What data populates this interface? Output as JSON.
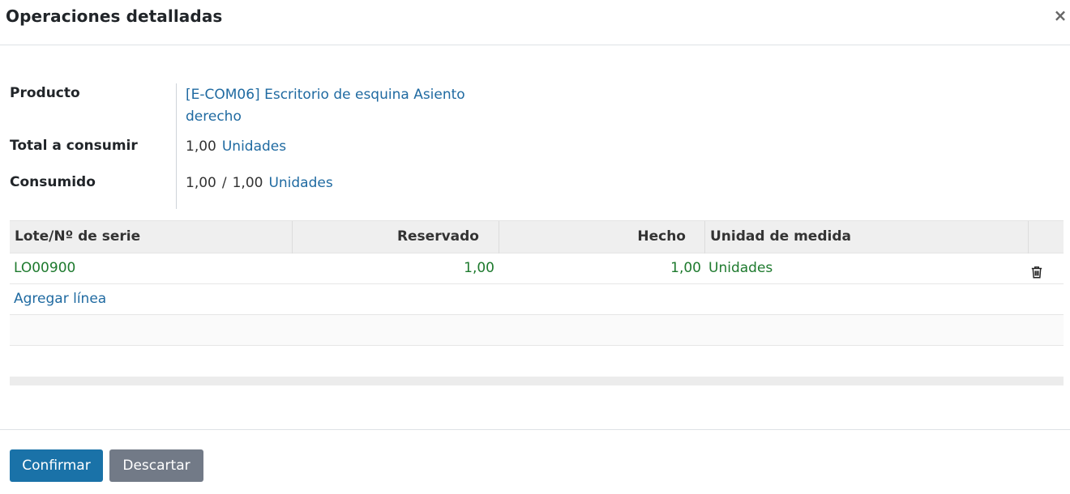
{
  "modal": {
    "title": "Operaciones detalladas",
    "close_label": "×"
  },
  "form": {
    "product_label": "Producto",
    "product_value": "[E-COM06] Escritorio de esquina Asiento derecho",
    "total_label": "Total a consumir",
    "total_qty": "1,00",
    "total_uom": "Unidades",
    "consumed_label": "Consumido",
    "consumed_qty": "1,00",
    "consumed_slash": "/",
    "consumed_total": "1,00",
    "consumed_uom": "Unidades"
  },
  "table": {
    "headers": {
      "lot": "Lote/Nº de serie",
      "reserved": "Reservado",
      "done": "Hecho",
      "uom": "Unidad de medida"
    },
    "rows": [
      {
        "lot": "LO00900",
        "reserved": "1,00",
        "done": "1,00",
        "uom": "Unidades"
      }
    ],
    "add_line_label": "Agregar línea"
  },
  "footer": {
    "confirm_label": "Confirmar",
    "discard_label": "Descartar"
  },
  "colors": {
    "primary": "#1a72a8",
    "secondary": "#727a87",
    "link": "#1f6aa1",
    "row_text": "#1e7a2e"
  }
}
